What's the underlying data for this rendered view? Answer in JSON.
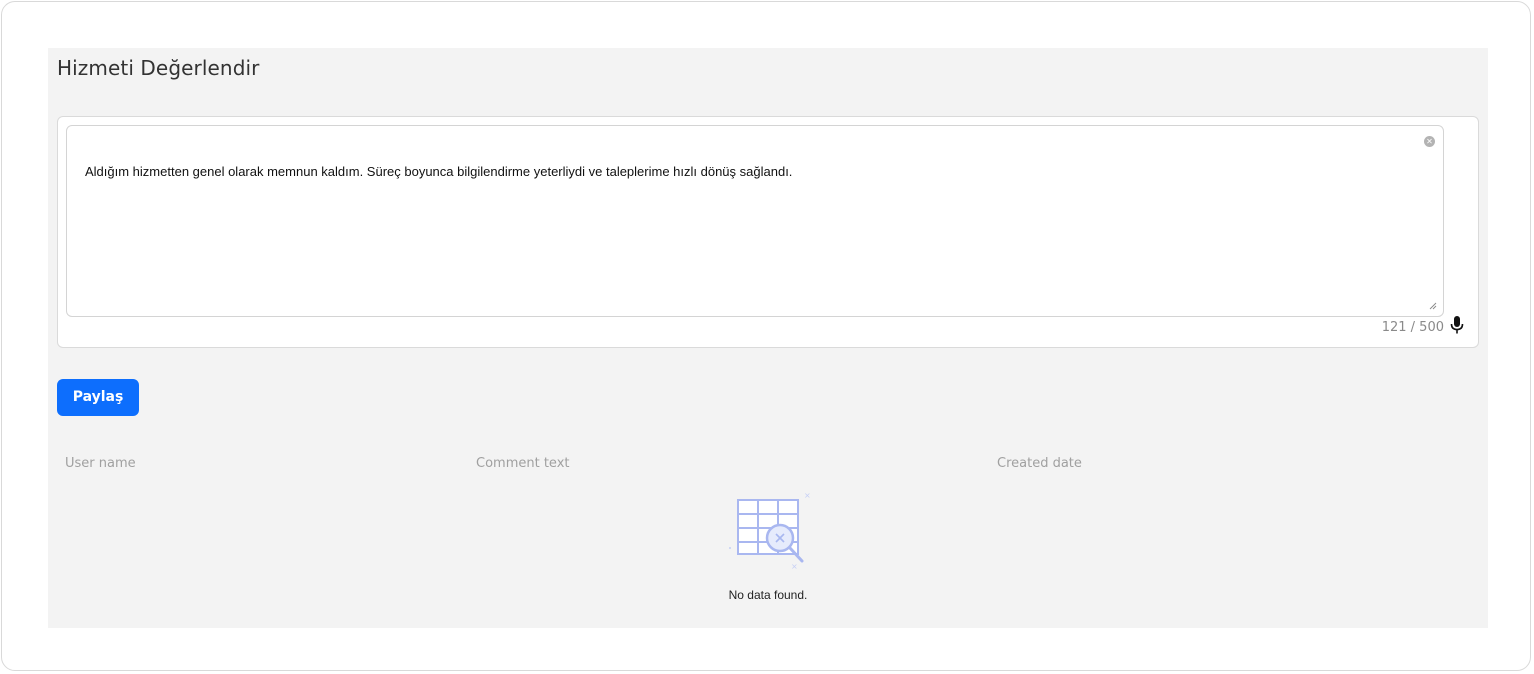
{
  "page": {
    "title": "Hizmeti Değerlendir"
  },
  "comment_field": {
    "value": "Aldığım hizmetten genel olarak memnun kaldım. Süreç boyunca bilgilendirme yeterliydi ve taleplerime hızlı dönüş sağlandı.",
    "counter": "121 / 500"
  },
  "actions": {
    "share_label": "Paylaş"
  },
  "table": {
    "columns": [
      "User name",
      "Comment text",
      "Created date"
    ],
    "rows": [],
    "empty_text": "No data found."
  },
  "icons": {
    "clear": "clear-icon",
    "resize": "resize-handle-icon",
    "mic": "microphone-icon",
    "empty": "no-data-table-search-icon"
  },
  "colors": {
    "primary": "#0d6efd",
    "panel_bg": "#f3f3f3",
    "illustration": "#a9b7f0"
  }
}
